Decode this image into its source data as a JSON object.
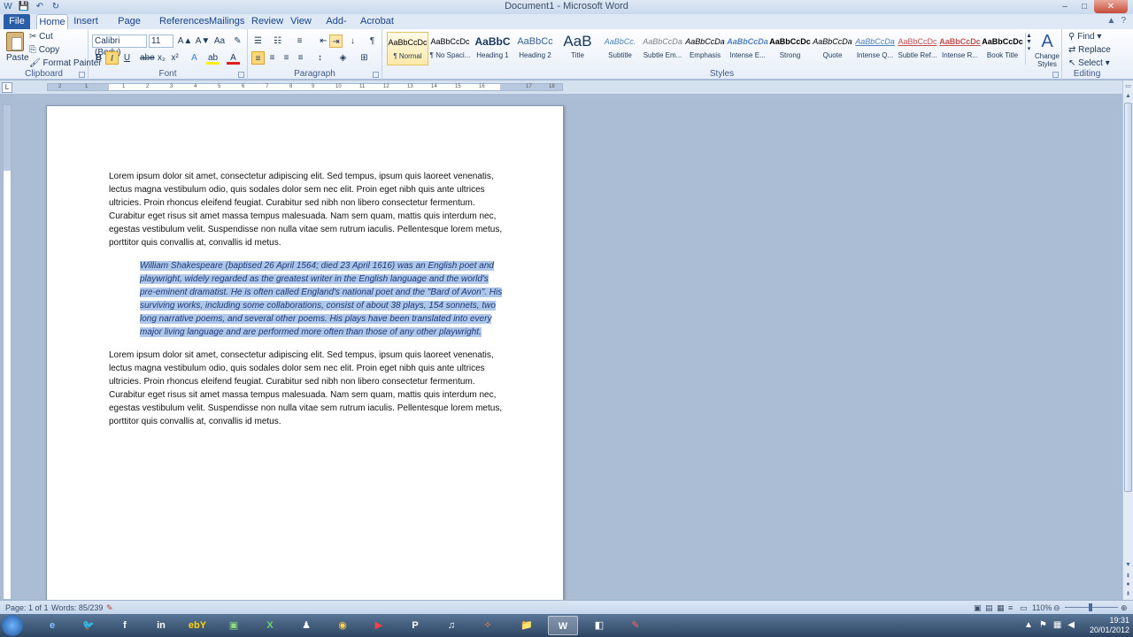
{
  "window": {
    "title": "Document1 - Microsoft Word",
    "qat": [
      "W",
      "💾",
      "↶",
      "↻"
    ],
    "controls": [
      "–",
      "□",
      "✕"
    ]
  },
  "tabs": [
    "File",
    "Home",
    "Insert",
    "Page Layout",
    "References",
    "Mailings",
    "Review",
    "View",
    "Add-Ins",
    "Acrobat"
  ],
  "ribbon": {
    "clipboard": {
      "label": "Clipboard",
      "paste": "Paste",
      "cut": "Cut",
      "copy": "Copy",
      "format_painter": "Format Painter"
    },
    "font": {
      "label": "Font",
      "family": "Calibri (Body)",
      "size": "11",
      "bold": "B",
      "italic": "I",
      "underline": "U",
      "strikethrough": "abe",
      "subscript": "x₂",
      "superscript": "x²",
      "grow": "A▲",
      "shrink": "A▼",
      "change_case": "Aa",
      "clear": "✎",
      "text_effects": "A",
      "highlight": "ab",
      "font_color": "A"
    },
    "paragraph": {
      "label": "Paragraph",
      "bullets": "☰",
      "numbering": "☷",
      "multilevel": "≡",
      "decrease_indent": "⇤",
      "increase_indent": "⇥",
      "sort": "↓",
      "show_marks": "¶",
      "align_left": "≡",
      "center": "≡",
      "align_right": "≡",
      "justify": "≡",
      "line_spacing": "↕",
      "shading": "◈",
      "borders": "⊞"
    },
    "styles": {
      "label": "Styles",
      "items": [
        {
          "sample": "AaBbCcDc",
          "name": "¶ Normal"
        },
        {
          "sample": "AaBbCcDc",
          "name": "¶ No Spaci..."
        },
        {
          "sample": "AaBbC",
          "name": "Heading 1"
        },
        {
          "sample": "AaBbCc",
          "name": "Heading 2"
        },
        {
          "sample": "AaB",
          "name": "Title"
        },
        {
          "sample": "AaBbCc.",
          "name": "Subtitle"
        },
        {
          "sample": "AaBbCcDa",
          "name": "Subtle Em..."
        },
        {
          "sample": "AaBbCcDa",
          "name": "Emphasis"
        },
        {
          "sample": "AaBbCcDa",
          "name": "Intense E..."
        },
        {
          "sample": "AaBbCcDc",
          "name": "Strong"
        },
        {
          "sample": "AaBbCcDa",
          "name": "Quote"
        },
        {
          "sample": "AaBbCcDa",
          "name": "Intense Q..."
        },
        {
          "sample": "AaBbCcDc",
          "name": "Subtle Ref..."
        },
        {
          "sample": "AaBbCcDc",
          "name": "Intense R..."
        },
        {
          "sample": "AaBbCcDc",
          "name": "Book Title"
        }
      ],
      "change_styles": "Change Styles"
    },
    "editing": {
      "label": "Editing",
      "find": "Find",
      "replace": "Replace",
      "select": "Select"
    }
  },
  "ruler_ticks": [
    "2",
    "1",
    "1",
    "2",
    "3",
    "4",
    "5",
    "6",
    "7",
    "8",
    "9",
    "10",
    "11",
    "12",
    "13",
    "14",
    "15",
    "16",
    "17",
    "18"
  ],
  "document": {
    "para1_lines": [
      "Lorem ipsum dolor sit amet, consectetur adipiscing elit. Sed tempus, ipsum quis laoreet venenatis,",
      "lectus magna vestibulum odio, quis sodales dolor sem nec elit. Proin eget nibh quis ante ultrices",
      "ultricies. Proin rhoncus eleifend feugiat. Curabitur sed nibh non libero consectetur fermentum.",
      "Curabitur eget risus sit amet massa tempus malesuada. Nam sem quam, mattis quis interdum nec,",
      "egestas vestibulum velit. Suspendisse non nulla vitae sem rutrum iaculis. Pellentesque lorem metus,",
      "porttitor quis convallis at, convallis id metus."
    ],
    "quote_lines": [
      "William Shakespeare (baptised 26 April 1564; died 23 April 1616) was an English poet and",
      "playwright, widely regarded as the greatest writer in the English language and the world's",
      "pre-eminent dramatist. He is often called England's national poet and the \"Bard of Avon\". His",
      "surviving works, including some collaborations, consist of about 38 plays, 154 sonnets, two",
      "long narrative poems, and several other poems. His plays have been translated into every",
      "major living language and are performed more often than those of any other playwright."
    ],
    "para2_lines": [
      "Lorem ipsum dolor sit amet, consectetur adipiscing elit. Sed tempus, ipsum quis laoreet venenatis,",
      "lectus magna vestibulum odio, quis sodales dolor sem nec elit. Proin eget nibh quis ante ultrices",
      "ultricies. Proin rhoncus eleifend feugiat. Curabitur sed nibh non libero consectetur fermentum.",
      "Curabitur eget risus sit amet massa tempus malesuada. Nam sem quam, mattis quis interdum nec,",
      "egestas vestibulum velit. Suspendisse non nulla vitae sem rutrum iaculis. Pellentesque lorem metus,",
      "porttitor quis convallis at, convallis id metus."
    ]
  },
  "statusbar": {
    "page": "Page: 1 of 1",
    "words": "Words: 85/239",
    "zoom": "110%"
  },
  "taskbar": {
    "apps": [
      {
        "icon": "e",
        "name": "internet-explorer"
      },
      {
        "icon": "🐦",
        "name": "twitter"
      },
      {
        "icon": "f",
        "name": "facebook"
      },
      {
        "icon": "in",
        "name": "linkedin"
      },
      {
        "icon": "ebY",
        "name": "ebay"
      },
      {
        "icon": "▣",
        "name": "app-green"
      },
      {
        "icon": "X",
        "name": "excel"
      },
      {
        "icon": "♟",
        "name": "app-people"
      },
      {
        "icon": "◉",
        "name": "app-ring"
      },
      {
        "icon": "▶",
        "name": "youtube"
      },
      {
        "icon": "P",
        "name": "publisher"
      },
      {
        "icon": "♫",
        "name": "itunes"
      },
      {
        "icon": "✧",
        "name": "app-star"
      },
      {
        "icon": "📁",
        "name": "explorer"
      },
      {
        "icon": "W",
        "name": "word"
      },
      {
        "icon": "◧",
        "name": "app-generic"
      },
      {
        "icon": "✎",
        "name": "app-pen"
      }
    ],
    "time": "19:31",
    "date": "20/01/2012"
  },
  "colors": {
    "selection": "#aec6e8",
    "file_tab": "#2a5ea8",
    "quote_text": "#1e3b7a"
  }
}
